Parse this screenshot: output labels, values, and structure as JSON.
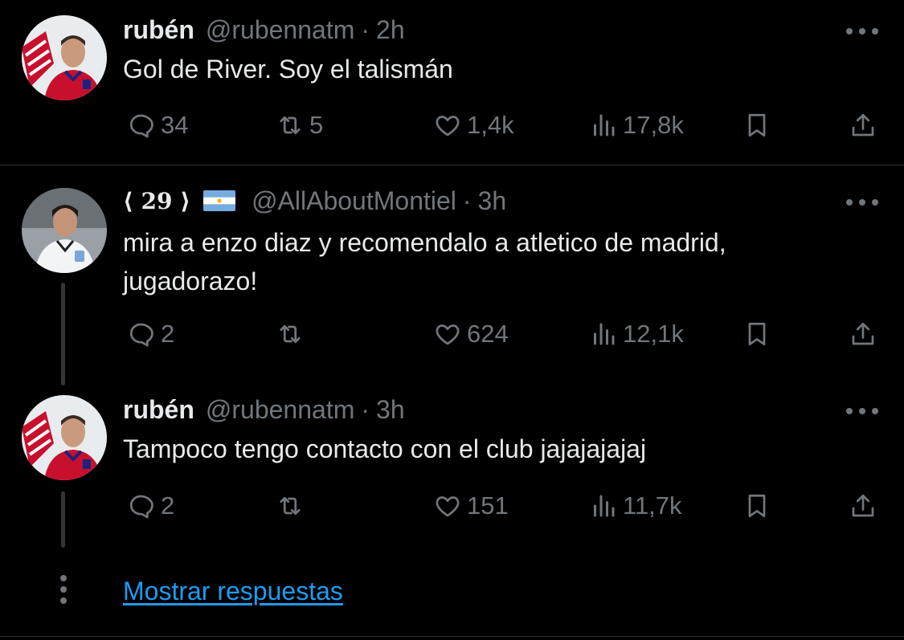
{
  "tweets": [
    {
      "name": "rubén",
      "handle": "@rubennatm",
      "time": "2h",
      "text": "Gol de River. Soy el talismán",
      "replies": "34",
      "retweets": "5",
      "likes": "1,4k",
      "views": "17,8k"
    },
    {
      "name": "⟨ 29 ⟩",
      "handle": "@AllAboutMontiel",
      "time": "3h",
      "text": "mira a enzo diaz y recomendalo a atletico de madrid, jugadorazo!",
      "replies": "2",
      "retweets": "",
      "likes": "624",
      "views": "12,1k"
    },
    {
      "name": "rubén",
      "handle": "@rubennatm",
      "time": "3h",
      "text": "Tampoco tengo contacto con el club jajajajajaj",
      "replies": "2",
      "retweets": "",
      "likes": "151",
      "views": "11,7k"
    }
  ],
  "separator": "·",
  "show_replies_link": "Mostrar respuestas",
  "colors": {
    "background": "#000000",
    "text_primary": "#e7e9ea",
    "text_secondary": "#71767b",
    "link": "#1d9bf0",
    "divider": "#2f3336"
  },
  "icons": [
    "reply-icon",
    "retweet-icon",
    "like-icon",
    "views-icon",
    "bookmark-icon",
    "share-icon",
    "more-icon",
    "argentina-flag-icon"
  ]
}
